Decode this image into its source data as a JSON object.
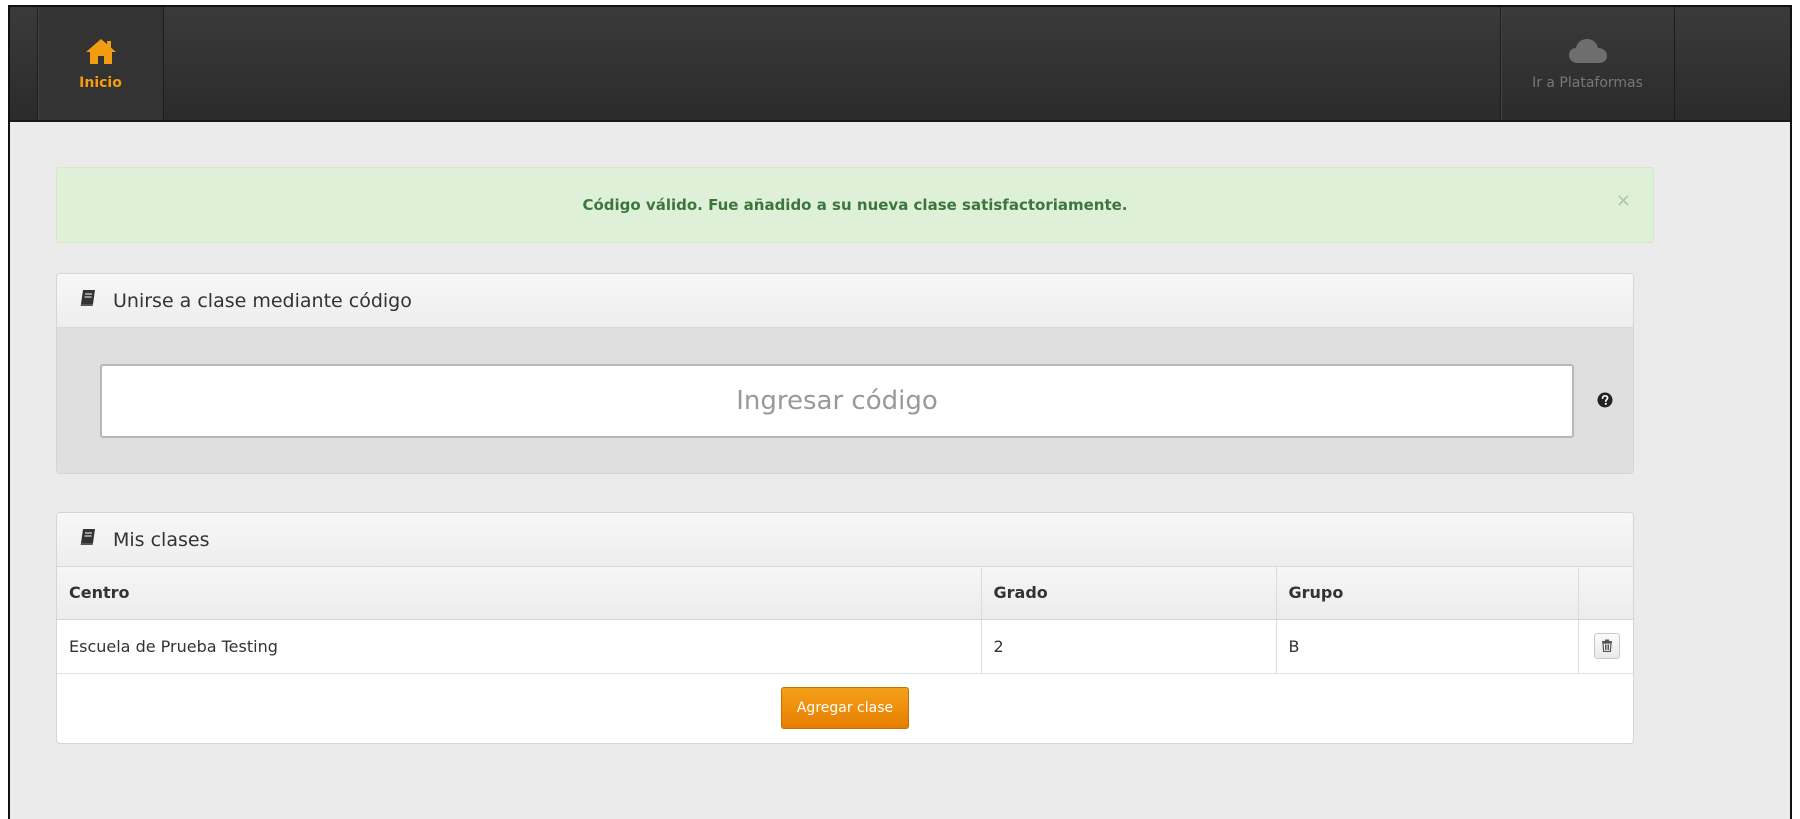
{
  "navbar": {
    "home": {
      "label": "Inicio",
      "icon": "home-icon",
      "color": "#f39c12"
    },
    "platforms": {
      "label": "Ir a Plataformas",
      "icon": "cloud-icon"
    }
  },
  "alert": {
    "message": "Código válido. Fue añadido a su nueva clase satisfactoriamente.",
    "close": "×"
  },
  "join_panel": {
    "title": "Unirse a clase mediante código",
    "icon": "book-icon",
    "input_placeholder": "Ingresar código",
    "input_value": "",
    "help_icon": "question-circle-icon"
  },
  "classes_panel": {
    "title": "Mis clases",
    "icon": "book-icon",
    "columns": [
      "Centro",
      "Grado",
      "Grupo"
    ],
    "rows": [
      {
        "centro": "Escuela de Prueba Testing",
        "grado": "2",
        "grupo": "B",
        "action_icon": "trash-icon"
      }
    ],
    "add_button": "Agregar clase"
  },
  "colors": {
    "accent": "#f39c12",
    "success_bg": "#dff0d8",
    "success_text": "#3c763d",
    "navbar_bg": "#2f2f2f"
  }
}
